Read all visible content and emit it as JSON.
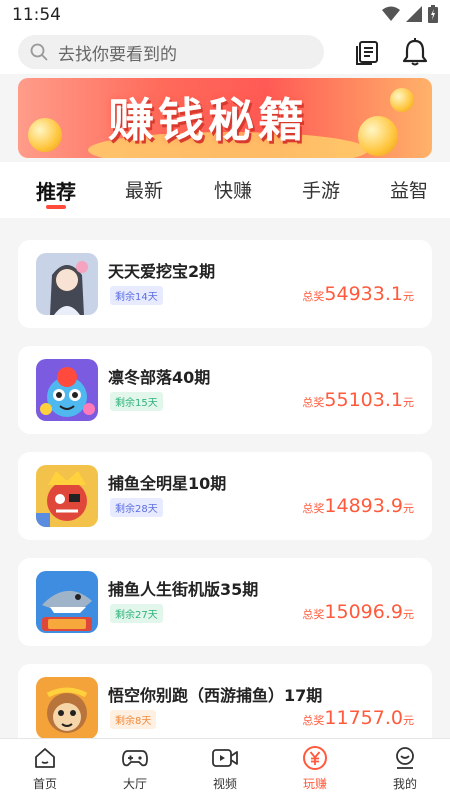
{
  "status": {
    "time": "11:54"
  },
  "search": {
    "placeholder": "去找你要看到的"
  },
  "banner": {
    "title": "赚钱秘籍"
  },
  "tabs": [
    {
      "label": "推荐",
      "active": true
    },
    {
      "label": "最新"
    },
    {
      "label": "快赚"
    },
    {
      "label": "手游"
    },
    {
      "label": "益智"
    }
  ],
  "items": [
    {
      "name": "天天爱挖宝2期",
      "remaining": "剩余14天",
      "prize_label": "总奖",
      "prize": "54933.1",
      "unit": "元",
      "badge_color": "#5b6ee1",
      "badge_bg": "#e8ebff",
      "icon": "girl-avatar-icon"
    },
    {
      "name": "凛冬部落40期",
      "remaining": "剩余15天",
      "prize_label": "总奖",
      "prize": "55103.1",
      "unit": "元",
      "badge_color": "#2fb37a",
      "badge_bg": "#e2f6ec",
      "icon": "cartoon-cat-icon"
    },
    {
      "name": "捕鱼全明星10期",
      "remaining": "剩余28天",
      "prize_label": "总奖",
      "prize": "14893.9",
      "unit": "元",
      "badge_color": "#5b6ee1",
      "badge_bg": "#e8ebff",
      "icon": "pirate-icon"
    },
    {
      "name": "捕鱼人生街机版35期",
      "remaining": "剩余27天",
      "prize_label": "总奖",
      "prize": "15096.9",
      "unit": "元",
      "badge_color": "#2fb37a",
      "badge_bg": "#e2f6ec",
      "icon": "shark-icon"
    },
    {
      "name": "悟空你别跑（西游捕鱼）17期",
      "remaining": "剩余8天",
      "prize_label": "总奖",
      "prize": "11757.0",
      "unit": "元",
      "badge_color": "#f08a3c",
      "badge_bg": "#fff0e2",
      "icon": "monkey-icon"
    }
  ],
  "nav": [
    {
      "label": "首页",
      "icon": "home-icon"
    },
    {
      "label": "大厅",
      "icon": "gamepad-icon"
    },
    {
      "label": "视频",
      "icon": "video-icon"
    },
    {
      "label": "玩赚",
      "icon": "yuan-coin-icon",
      "active": true
    },
    {
      "label": "我的",
      "icon": "profile-icon"
    }
  ],
  "colors": {
    "accent": "#ff5a3c",
    "tab_underline": "#ff4b3a"
  }
}
